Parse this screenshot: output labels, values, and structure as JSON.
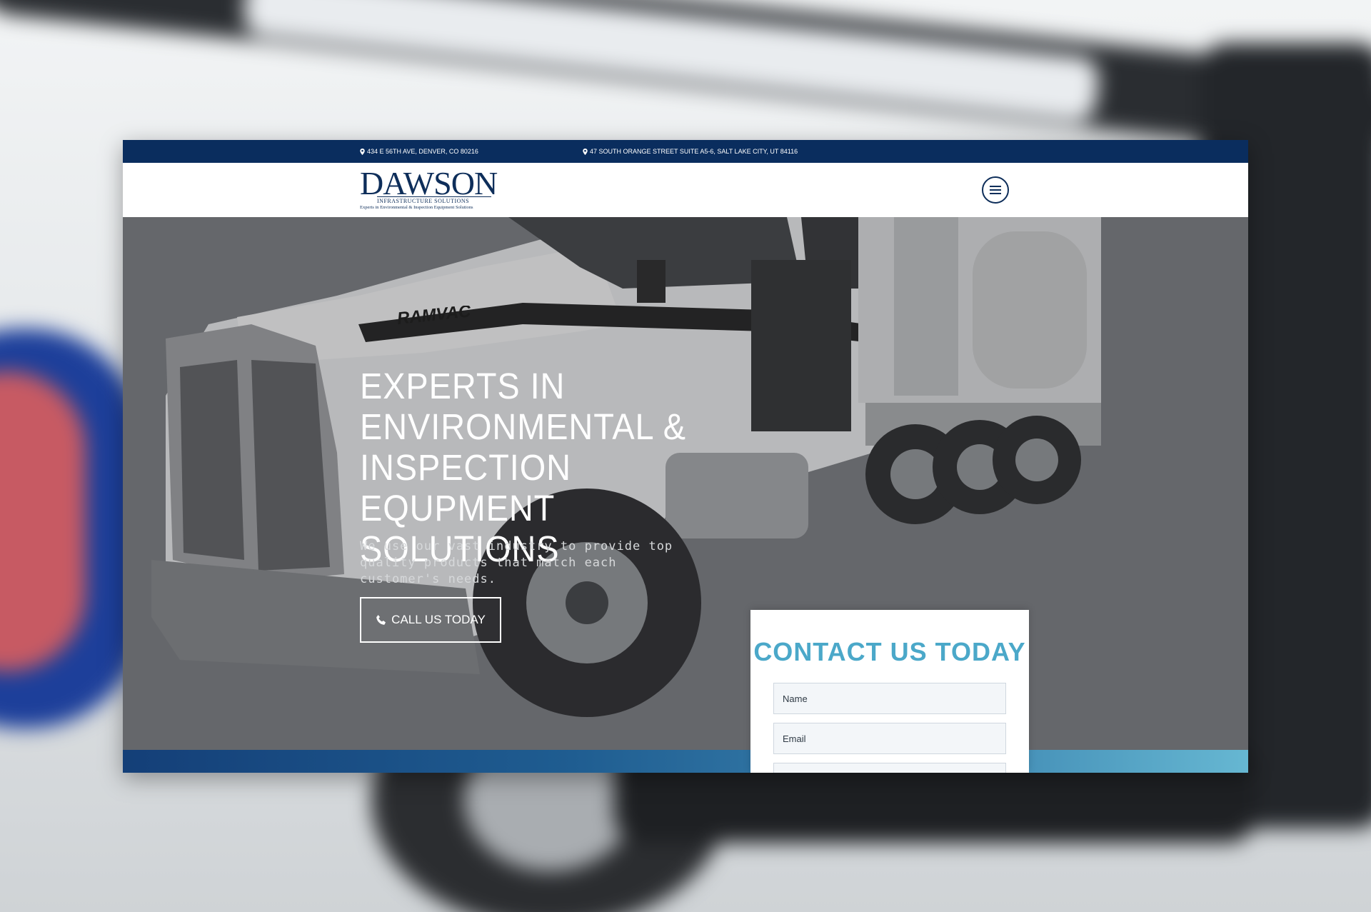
{
  "topbar": {
    "address_1": "434 E 56TH AVE, DENVER, CO 80216",
    "address_2": "47 SOUTH ORANGE STREET SUITE A5-6, SALT LAKE CITY, UT 84116"
  },
  "header": {
    "logo_word": "DAWSON",
    "logo_sub": "INFRASTRUCTURE SOLUTIONS",
    "logo_tagline": "Experts in Environmental & Inspection Equipment Solutions",
    "menu_icon": "hamburger-menu-icon"
  },
  "hero": {
    "title": "EXPERTS IN ENVIRONMENTAL & INSPECTION EQUPMENT SOLUTIONS",
    "subtitle": "We use our vast industry to provide top quality products that match each customer's needs.",
    "cta_label": "CALL US TODAY",
    "cta_icon": "phone-icon",
    "truck_brand": "RAMVAC"
  },
  "contact": {
    "heading": "CONTACT US TODAY",
    "name_placeholder": "Name",
    "email_placeholder": "Email"
  },
  "colors": {
    "navy": "#0a2d5e",
    "accent": "#4ba8c9",
    "hero_overlay": "#75787c"
  }
}
